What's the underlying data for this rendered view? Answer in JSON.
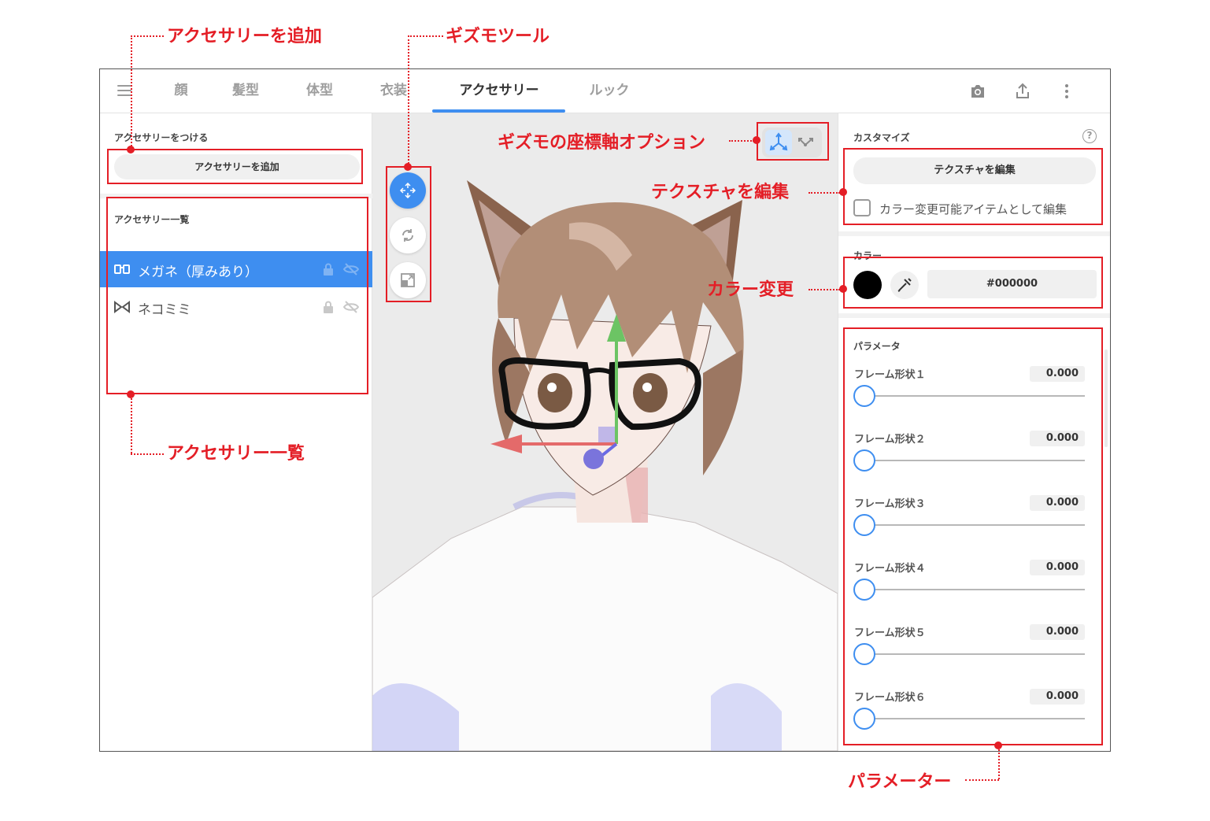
{
  "annotations": {
    "add_accessory": "アクセサリーを追加",
    "gizmo_tool": "ギズモツール",
    "gizmo_axis_option": "ギズモの座標軸オプション",
    "edit_texture": "テクスチャを編集",
    "color_change": "カラー変更",
    "accessory_list": "アクセサリー一覧",
    "parameter": "パラメーター",
    "accent_color": "#e41e26"
  },
  "header": {
    "menu_icon": "hamburger-icon",
    "tabs": [
      {
        "label": "顔",
        "active": false
      },
      {
        "label": "髪型",
        "active": false
      },
      {
        "label": "体型",
        "active": false
      },
      {
        "label": "衣装",
        "active": false
      },
      {
        "label": "アクセサリー",
        "active": true
      },
      {
        "label": "ルック",
        "active": false
      }
    ],
    "actions": [
      "camera-icon",
      "share-icon",
      "more-vertical-icon"
    ],
    "accent_color": "#3e8ef0"
  },
  "left_panel": {
    "attach_section_label": "アクセサリーをつける",
    "add_button_label": "アクセサリーを追加",
    "list_section_label": "アクセサリー一覧",
    "items": [
      {
        "name": "メガネ（厚みあり）",
        "icon": "glasses-icon",
        "selected": true
      },
      {
        "name": "ネコミミ",
        "icon": "bowtie-icon",
        "selected": false
      }
    ]
  },
  "viewport": {
    "gizmo_tools": [
      {
        "name": "move-tool",
        "icon": "move-icon",
        "active": true
      },
      {
        "name": "rotate-tool",
        "icon": "rotate-icon",
        "active": false
      },
      {
        "name": "scale-tool",
        "icon": "scale-icon",
        "active": false
      }
    ],
    "axis_options": [
      {
        "name": "global-axis",
        "icon": "global-axis-icon",
        "active": true
      },
      {
        "name": "local-axis",
        "icon": "local-axis-icon",
        "active": false
      }
    ]
  },
  "right_panel": {
    "customize_label": "カスタマイズ",
    "help_icon": "help-icon",
    "help_glyph": "?",
    "edit_texture_button": "テクスチャを編集",
    "color_editable_checkbox_label": "カラー変更可能アイテムとして編集",
    "color_editable_checked": false,
    "color_section_label": "カラー",
    "color_swatch": "#000000",
    "color_hex_value": "#000000",
    "parameters_label": "パラメータ",
    "parameters": [
      {
        "label": "フレーム形状１",
        "value": "0.000",
        "level": 0
      },
      {
        "label": "フレーム形状２",
        "value": "0.000",
        "level": 0
      },
      {
        "label": "フレーム形状３",
        "value": "0.000",
        "level": 0
      },
      {
        "label": "フレーム形状４",
        "value": "0.000",
        "level": 0
      },
      {
        "label": "フレーム形状５",
        "value": "0.000",
        "level": 0
      },
      {
        "label": "フレーム形状６",
        "value": "0.000",
        "level": 0
      }
    ]
  }
}
